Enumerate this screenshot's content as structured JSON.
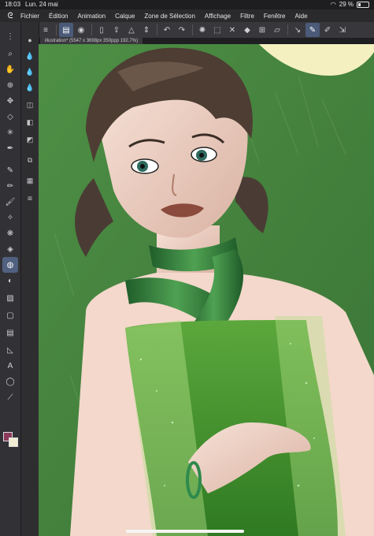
{
  "status": {
    "time": "18:03",
    "date": "Lun. 24 mai",
    "battery": "29 %",
    "battery_level": 0.29
  },
  "menu": [
    "Fichier",
    "Édition",
    "Animation",
    "Calque",
    "Zone de Sélection",
    "Affichage",
    "Filtre",
    "Fenêtre",
    "Aide"
  ],
  "canvas_tab": {
    "label": "illustration* (5547 x 3698px 350ppp 192.7%)"
  },
  "colors": {
    "main": "#8b3a5a",
    "sub": "#f2ecd4",
    "accent": "#4f6080"
  },
  "toolbar_icons": [
    "menu-icon",
    "layer-icon",
    "stabilizer-icon",
    "new-page-icon",
    "upload-icon",
    "fill-icon",
    "stepper-icon",
    "undo-icon",
    "redo-icon",
    "select-all-icon",
    "deselect-icon",
    "clear-icon",
    "fill-selection-icon",
    "transform-icon",
    "ruler-icon",
    "pen-active-icon",
    "edit-icon",
    "fit-icon"
  ],
  "left_tools": [
    "hand-icon",
    "zoom-icon",
    "move-icon",
    "transform-icon",
    "select-icon",
    "magic-wand-icon",
    "eyedropper-icon",
    "pen-icon",
    "pencil-icon",
    "brush-icon",
    "airbrush-icon",
    "decoration-icon",
    "eraser-icon",
    "blend-icon",
    "fill-icon",
    "gradient-icon",
    "figure-icon",
    "frame-icon",
    "ruler-icon",
    "text-icon",
    "balloon-icon",
    "correction-icon"
  ],
  "sub_tools": [
    "sub-tool-1",
    "sub-tool-2",
    "sub-tool-3",
    "sub-tool-4",
    "sub-tool-5",
    "sub-tool-6",
    "sub-tool-7",
    "sub-tool-8",
    "sub-tool-9",
    "sub-tool-10"
  ]
}
